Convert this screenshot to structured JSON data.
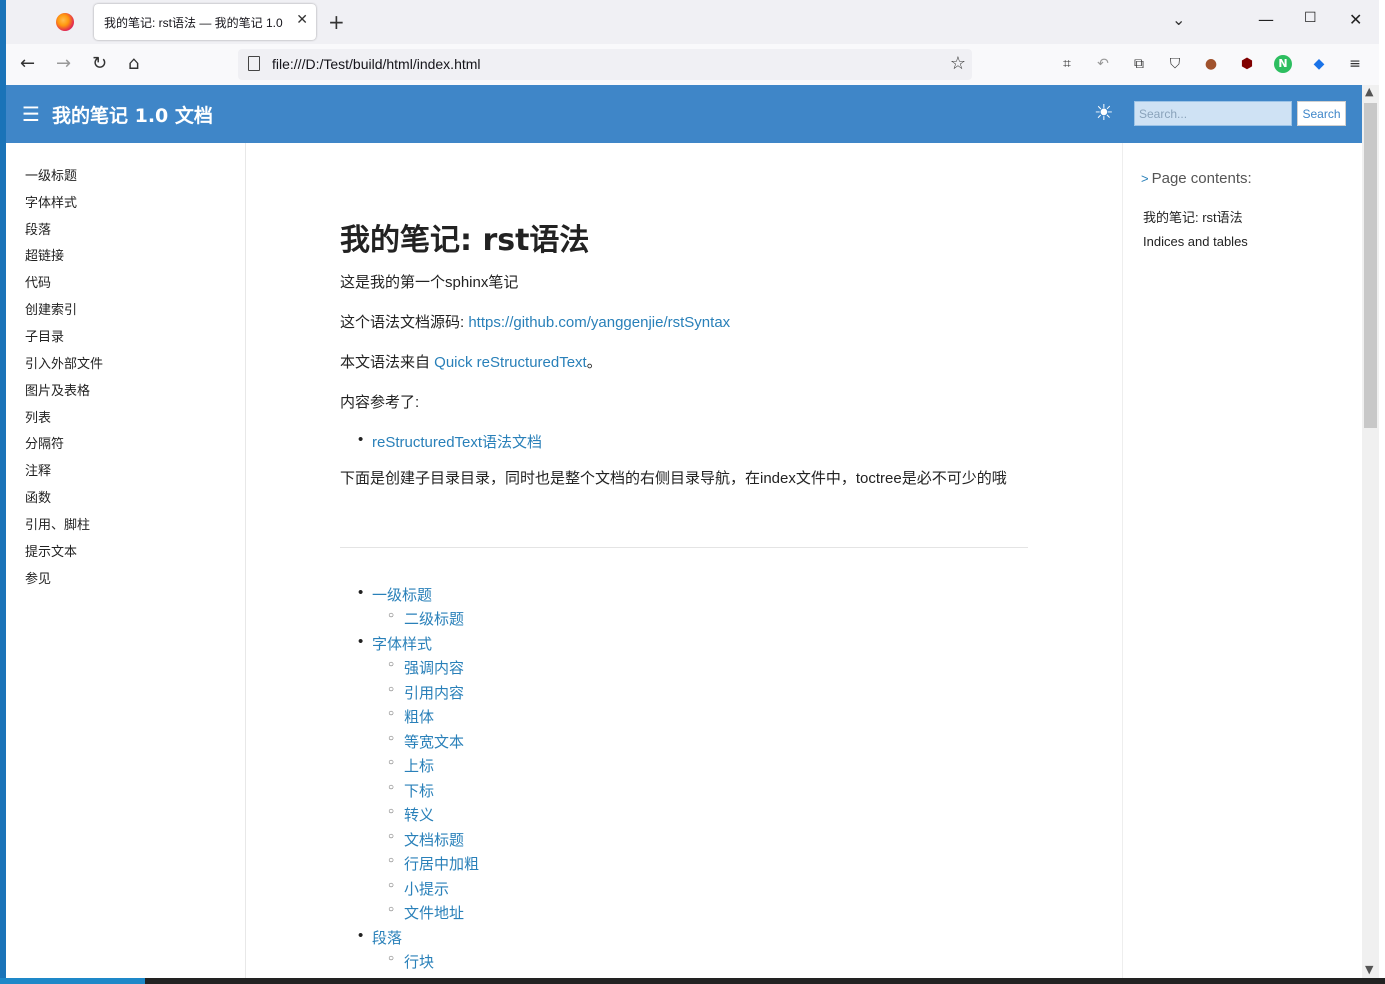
{
  "browser": {
    "tab_title": "我的笔记: rst语法 — 我的笔记 1.0 文档",
    "url": "file:///D:/Test/build/html/index.html"
  },
  "site": {
    "title": "我的笔记 1.0 文档",
    "search_placeholder": "Search...",
    "search_button": "Search",
    "accent_color": "#3f86c8",
    "link_color": "#2980b9"
  },
  "sidebar": {
    "items": [
      "一级标题",
      "字体样式",
      "段落",
      "超链接",
      "代码",
      "创建索引",
      "子目录",
      "引入外部文件",
      "图片及表格",
      "列表",
      "分隔符",
      "注释",
      "函数",
      "引用、脚柱",
      "提示文本",
      "参见"
    ]
  },
  "main": {
    "title": "我的笔记: rst语法",
    "p1": "这是我的第一个sphinx笔记",
    "p2_prefix": "这个语法文档源码: ",
    "p2_link": "https://github.com/yanggenjie/rstSyntax",
    "p3_prefix": "本文语法来自 ",
    "p3_link": "Quick reStructuredText",
    "p3_suffix": "。",
    "p4": "内容参考了:",
    "ref_link": "reStructuredText语法文档",
    "p5": "下面是创建子目录目录，同时也是整个文档的右侧目录导航，在index文件中，toctree是必不可少的哦",
    "toc": [
      {
        "label": "一级标题",
        "children": [
          "二级标题"
        ]
      },
      {
        "label": "字体样式",
        "children": [
          "强调内容",
          "引用内容",
          "粗体",
          "等宽文本",
          "上标",
          "下标",
          "转义",
          "文档标题",
          "行居中加粗",
          "小提示",
          "文件地址"
        ]
      },
      {
        "label": "段落",
        "children": [
          "行块"
        ]
      }
    ]
  },
  "right_toc": {
    "heading": "Page contents:",
    "items": [
      "我的笔记: rst语法",
      "Indices and tables"
    ]
  }
}
